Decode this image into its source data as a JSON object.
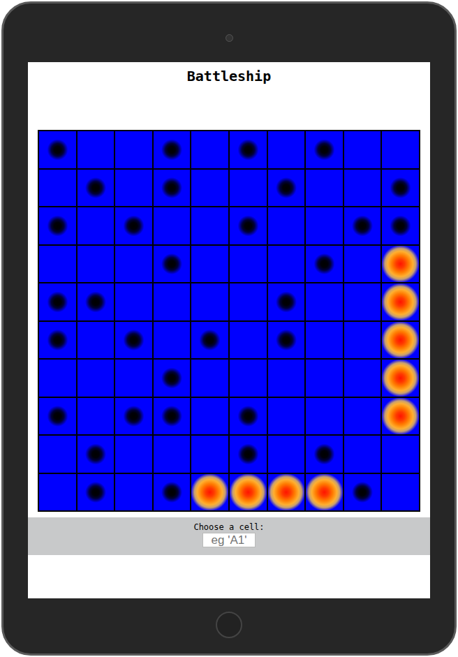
{
  "title": "Battleship",
  "grid": {
    "rows": [
      [
        "miss",
        "empty",
        "empty",
        "miss",
        "empty",
        "miss",
        "empty",
        "miss",
        "empty",
        "empty"
      ],
      [
        "empty",
        "miss",
        "empty",
        "miss",
        "empty",
        "empty",
        "miss",
        "empty",
        "empty",
        "miss"
      ],
      [
        "miss",
        "empty",
        "miss",
        "empty",
        "empty",
        "miss",
        "empty",
        "empty",
        "miss",
        "miss"
      ],
      [
        "empty",
        "empty",
        "empty",
        "miss",
        "empty",
        "empty",
        "empty",
        "miss",
        "empty",
        "hit"
      ],
      [
        "miss",
        "miss",
        "empty",
        "empty",
        "empty",
        "empty",
        "miss",
        "empty",
        "empty",
        "hit"
      ],
      [
        "miss",
        "empty",
        "miss",
        "empty",
        "miss",
        "empty",
        "miss",
        "empty",
        "empty",
        "hit"
      ],
      [
        "empty",
        "empty",
        "empty",
        "miss",
        "empty",
        "empty",
        "empty",
        "empty",
        "empty",
        "hit"
      ],
      [
        "miss",
        "empty",
        "miss",
        "miss",
        "empty",
        "miss",
        "empty",
        "empty",
        "empty",
        "hit"
      ],
      [
        "empty",
        "miss",
        "empty",
        "empty",
        "empty",
        "miss",
        "empty",
        "miss",
        "empty",
        "empty"
      ],
      [
        "empty",
        "miss",
        "empty",
        "miss",
        "hit",
        "hit",
        "hit",
        "hit",
        "miss",
        "empty"
      ]
    ]
  },
  "form": {
    "label": "Choose a cell:",
    "placeholder": "eg 'A1'"
  }
}
